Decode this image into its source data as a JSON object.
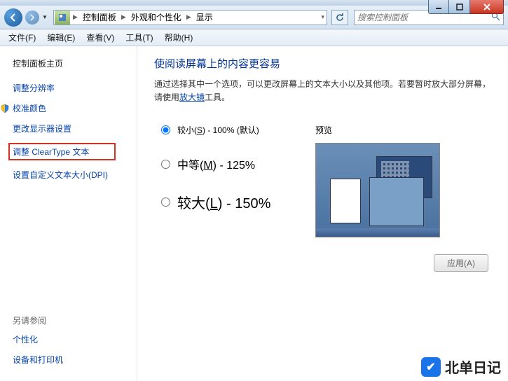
{
  "window": {
    "breadcrumb": [
      "控制面板",
      "外观和个性化",
      "显示"
    ],
    "search_placeholder": "搜索控制面板"
  },
  "menu": {
    "file": "文件(F)",
    "edit": "编辑(E)",
    "view": "查看(V)",
    "tools": "工具(T)",
    "help": "帮助(H)"
  },
  "sidebar": {
    "home": "控制面板主页",
    "links": [
      "调整分辨率",
      "校准颜色",
      "更改显示器设置",
      "调整 ClearType 文本",
      "设置自定义文本大小(DPI)"
    ],
    "seealso_header": "另请参阅",
    "seealso": [
      "个性化",
      "设备和打印机"
    ]
  },
  "main": {
    "heading": "使阅读屏幕上的内容更容易",
    "desc_pre": "通过选择其中一个选项，可以更改屏幕上的文本大小以及其他项。若要暂时放大部分屏幕，请使用",
    "desc_link": "放大镜",
    "desc_post": "工具。",
    "options": [
      {
        "label_pre": "较小(",
        "key": "S",
        "label_post": ") - 100% (默认)",
        "checked": true,
        "size": "sm"
      },
      {
        "label_pre": "中等(",
        "key": "M",
        "label_post": ") - 125%",
        "checked": false,
        "size": "lg"
      },
      {
        "label_pre": "较大(",
        "key": "L",
        "label_post": ") - 150%",
        "checked": false,
        "size": "xl"
      }
    ],
    "preview_label": "预览",
    "apply_label": "应用(A)"
  },
  "watermark": {
    "text": "北单日记"
  }
}
